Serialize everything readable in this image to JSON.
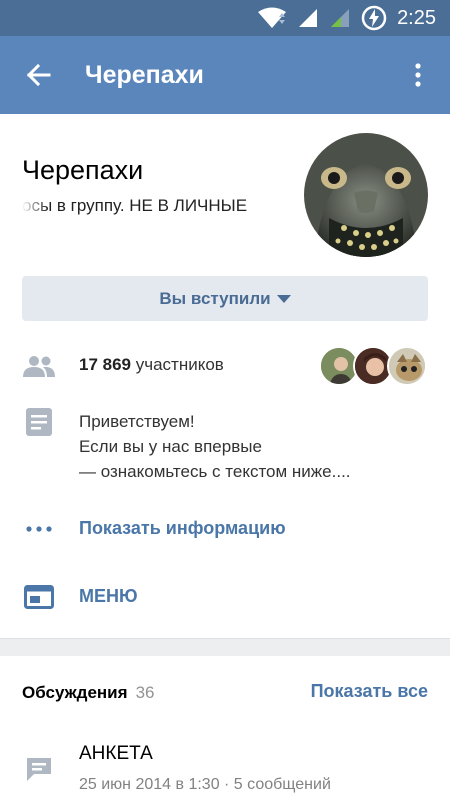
{
  "status_bar": {
    "time": "2:25"
  },
  "app_bar": {
    "title": "Черепахи",
    "back_icon": "arrow-back-icon",
    "more_icon": "more-vert-icon"
  },
  "group": {
    "name": "Черепахи",
    "status": "осы в группу. НЕ В ЛИЧНЫЕ"
  },
  "join_button": {
    "label": "Вы вступили"
  },
  "members": {
    "count": "17 869",
    "label": "участников"
  },
  "description": {
    "line1": "Приветствуем!",
    "line2": "Если вы у нас впервые",
    "line3": "— ознакомьтесь с текстом ниже...."
  },
  "info_link": {
    "label": "Показать информацию"
  },
  "menu_link": {
    "label": "МЕНЮ"
  },
  "discussions": {
    "title": "Обсуждения",
    "count": "36",
    "show_all": "Показать все",
    "topics": [
      {
        "title": "АНКЕТА",
        "meta": "25 июн 2014 в 1:30 · 5 сообщений"
      }
    ]
  },
  "colors": {
    "status_bar": "#4a6e95",
    "app_bar": "#5b86bb",
    "link": "#4a76a8",
    "button_bg": "#e4e9ef"
  }
}
